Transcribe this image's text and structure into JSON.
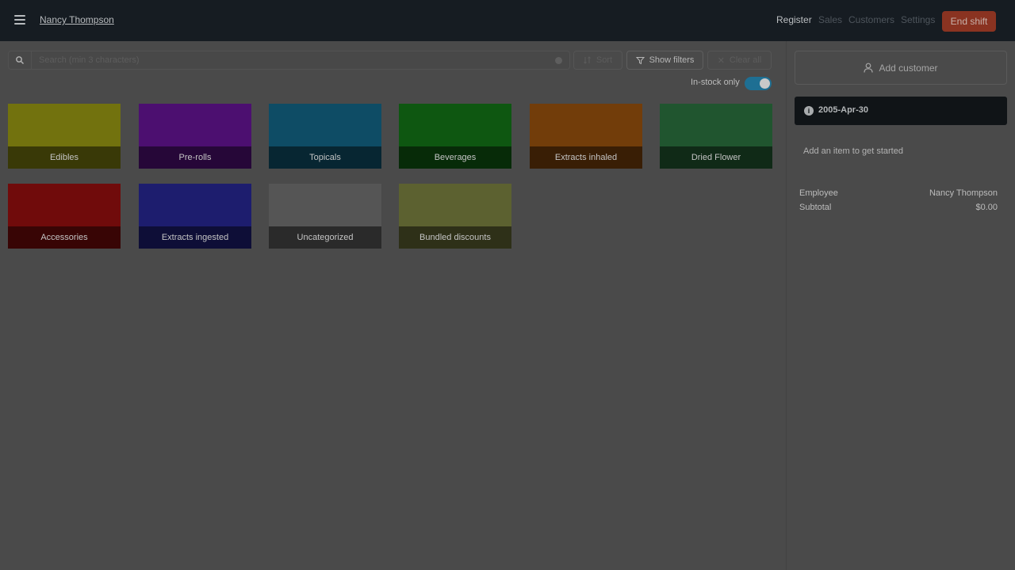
{
  "header": {
    "user_name": "Nancy Thompson",
    "nav": [
      {
        "label": "Register",
        "active": true
      },
      {
        "label": "Sales",
        "active": false
      },
      {
        "label": "Customers",
        "active": false
      },
      {
        "label": "Settings",
        "active": false
      }
    ],
    "end_shift_label": "End shift",
    "end_shift_color": "#c84a2f"
  },
  "toolbar": {
    "search_placeholder": "Search (min 3 characters)",
    "sort_label": "Sort",
    "show_filters_label": "Show filters",
    "clear_all_label": "Clear all",
    "instock_label": "In-stock only",
    "instock_enabled": true
  },
  "categories": [
    {
      "label": "Edibles",
      "color": "#d0d01a"
    },
    {
      "label": "Pre-rolls",
      "color": "#8b1ccc"
    },
    {
      "label": "Topicals",
      "color": "#1a8bb8"
    },
    {
      "label": "Beverages",
      "color": "#1a9f1e"
    },
    {
      "label": "Extracts inhaled",
      "color": "#d06e12"
    },
    {
      "label": "Dried Flower",
      "color": "#3a9a56"
    },
    {
      "label": "Accessories",
      "color": "#cc1414"
    },
    {
      "label": "Extracts ingested",
      "color": "#3434c8"
    },
    {
      "label": "Uncategorized",
      "color": "#9a9a9a"
    },
    {
      "label": "Bundled discounts",
      "color": "#a8b058"
    }
  ],
  "cart": {
    "add_customer_label": "Add customer",
    "date": "2005-Apr-30",
    "empty_message": "Add an item to get started",
    "employee_label": "Employee",
    "employee_value": "Nancy Thompson",
    "subtotal_label": "Subtotal",
    "subtotal_value": "$0.00"
  }
}
